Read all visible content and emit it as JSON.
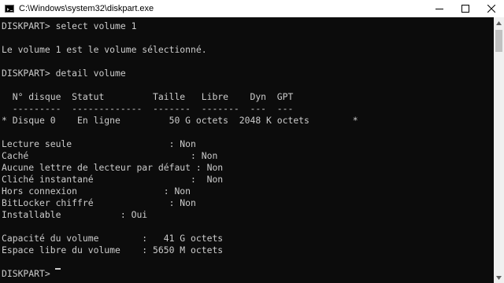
{
  "window": {
    "title": "C:\\Windows\\system32\\diskpart.exe",
    "icons": {
      "app": "console-app-icon",
      "minimize": "minimize-icon",
      "maximize": "maximize-icon",
      "close": "close-icon"
    }
  },
  "console": {
    "lines": [
      "DISKPART> select volume 1",
      "",
      "Le volume 1 est le volume sélectionné.",
      "",
      "DISKPART> detail volume",
      "",
      "  N° disque  Statut         Taille   Libre    Dyn  GPT",
      "  ---------  -------------  -------  -------  ---  ---",
      "* Disque 0    En ligne         50 G octets  2048 K octets        *",
      "",
      "Lecture seule                  : Non",
      "Caché                              : Non",
      "Aucune lettre de lecteur par défaut : Non",
      "Cliché instantané                  :  Non",
      "Hors connexion                : Non",
      "BitLocker chiffré              : Non",
      "Installable           : Oui",
      "",
      "Capacité du volume        :   41 G octets",
      "Espace libre du volume    : 5650 M octets",
      "",
      "DISKPART> "
    ]
  },
  "scrollbar": {
    "icons": {
      "up": "scroll-up-arrow-icon",
      "down": "scroll-down-arrow-icon"
    }
  }
}
